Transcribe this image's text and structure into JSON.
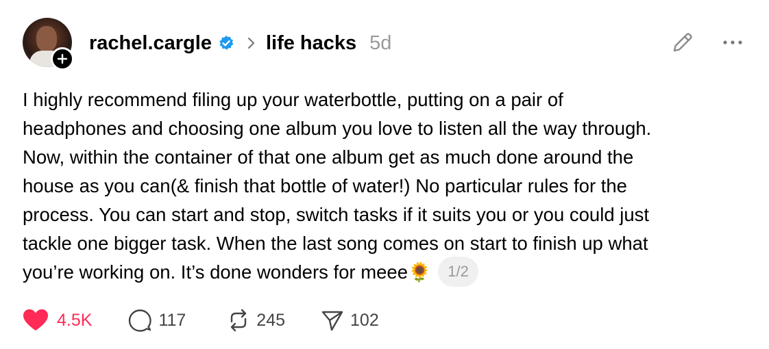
{
  "post": {
    "author": "rachel.cargle",
    "topic": "life hacks",
    "time": "5d",
    "text_lines": [
      "I highly recommend filing up your waterbottle, putting on a pair of",
      "headphones and choosing one album you love to listen all the way through.",
      "Now, within the container of that one album get as much done around the",
      "house as you can(& finish that bottle of water!) No particular rules for the",
      "process. You can start and stop, switch tasks if it suits you or you could just",
      "tackle one bigger task. When the last song comes on start to finish up what",
      "you’re working on. It’s done wonders for meee🌻"
    ],
    "page_indicator": "1/2"
  },
  "actions": {
    "likes": "4.5K",
    "replies": "117",
    "reposts": "245",
    "shares": "102"
  },
  "icons": {
    "verified": "verified-badge-icon",
    "follow": "plus-icon",
    "edit": "pencil-icon",
    "more": "more-dots-icon",
    "like": "heart-icon",
    "reply": "comment-icon",
    "repost": "repost-icon",
    "share": "send-icon"
  },
  "colors": {
    "like": "#ff2a55",
    "verified": "#1d9bf0",
    "muted": "#9a9a9a"
  }
}
